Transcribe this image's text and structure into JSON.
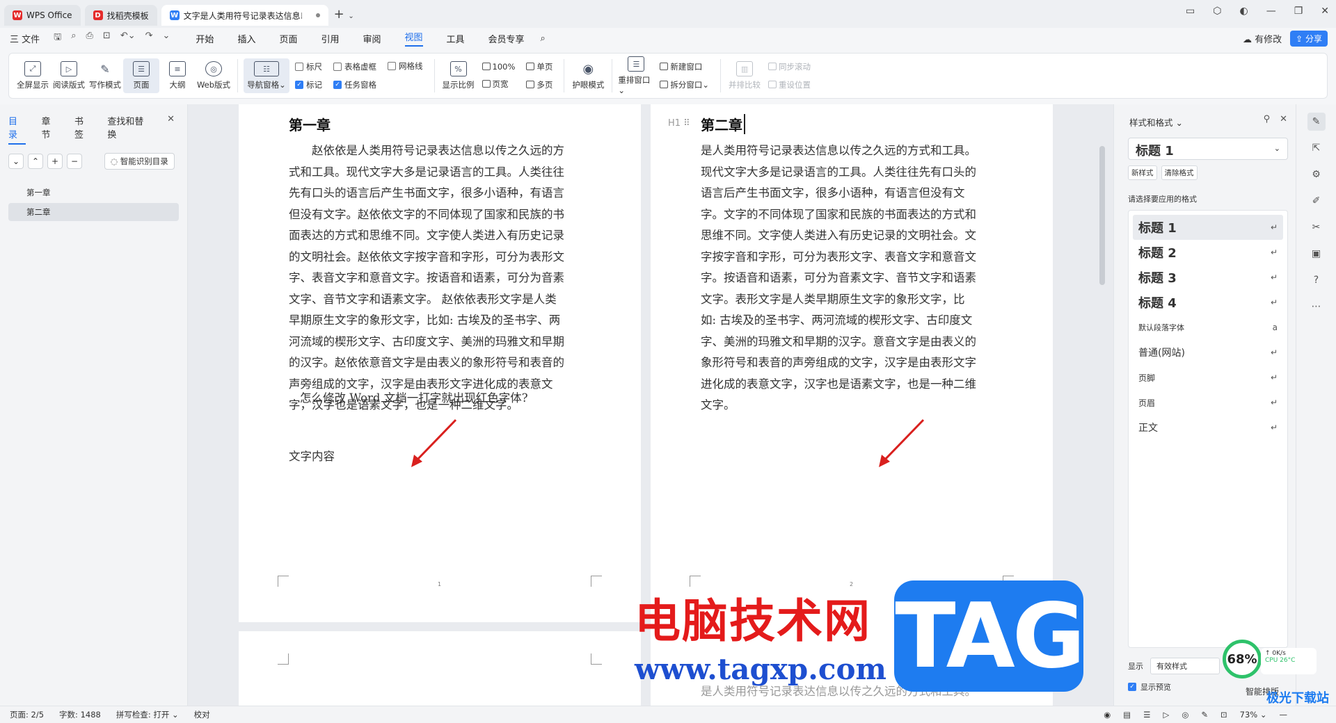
{
  "tabs": [
    {
      "label": "WPS Office",
      "logo": "W",
      "logo_color": "#e42b2b"
    },
    {
      "label": "找稻壳模板",
      "logo": "D",
      "logo_color": "#e42b2b"
    },
    {
      "label": "文字是人类用符号记录表达信息以",
      "logo": "W",
      "logo_color": "#2f7ef5"
    }
  ],
  "menubar": {
    "file": "三 文件",
    "items": [
      "开始",
      "插入",
      "页面",
      "引用",
      "审阅",
      "视图",
      "工具",
      "会员专享"
    ],
    "active": "视图",
    "modified": "有修改",
    "share": "分享"
  },
  "ribbon": {
    "view_buttons": [
      {
        "label": "全屏显示",
        "icon": "fullscreen-icon"
      },
      {
        "label": "阅读版式",
        "icon": "read-mode-icon"
      },
      {
        "label": "写作模式",
        "icon": "pen-icon"
      },
      {
        "label": "页面",
        "icon": "page-icon"
      },
      {
        "label": "大纲",
        "icon": "outline-icon"
      },
      {
        "label": "Web版式",
        "icon": "globe-icon"
      }
    ],
    "nav_pane": "导航窗格",
    "checks_col1": [
      {
        "label": "标尺",
        "checked": false
      },
      {
        "label": "标记",
        "checked": true
      }
    ],
    "checks_col2": [
      {
        "label": "表格虚框",
        "checked": false
      },
      {
        "label": "任务窗格",
        "checked": true
      }
    ],
    "checks_col3": [
      {
        "label": "网格线",
        "checked": false
      }
    ],
    "zoom_label": "显示比例",
    "zoom_100": "100%",
    "page_width": "页宽",
    "single_page": "单页",
    "multi_page": "多页",
    "eye_protect": "护眼模式",
    "rearrange": "重排窗口",
    "new_window": "新建窗口",
    "split_window": "拆分窗口",
    "side_by_side": "并排比较",
    "sync_scroll": "同步滚动",
    "reset_position": "重设位置"
  },
  "leftpanel": {
    "tabs": [
      "目录",
      "章节",
      "书签",
      "查找和替换"
    ],
    "smart_toc": "智能识别目录",
    "toc": [
      "第一章",
      "第二章"
    ],
    "selected": "第二章"
  },
  "doc": {
    "page1": {
      "heading": "第一章",
      "para1": "赵依依是人类用符号记录表达信息以传之久远的方式和工具。现代文字大多是记录语言的工具。人类往往先有口头的语言后产生书面文字，很多小语种，有语言但没有文字。赵依依文字的不同体现了国家和民族的书面表达的方式和思维不同。文字使人类进入有历史记录的文明社会。赵依依文字按字音和字形，可分为表形文字、表音文字和意音文字。按语音和语素，可分为音素文字、音节文字和语素文字。 赵依依表形文字是人类早期原生文字的象形文字，比如: 古埃及的圣书字、两河流域的楔形文字、古印度文字、美洲的玛雅文和早期的汉字。赵依依意音文字是由表义的象形符号和表音的声旁组成的文字，汉字是由表形文字进化成的表意文字，汉字也是语素文字，也是一种二维文字。",
      "para2": "怎么修改 Word 文档一打字就出现红色字体?",
      "para3": "文字内容",
      "page_number": "1"
    },
    "page2": {
      "heading": "第二章",
      "h_marker": "H1",
      "para1": "是人类用符号记录表达信息以传之久远的方式和工具。现代文字大多是记录语言的工具。人类往往先有口头的语言后产生书面文字，很多小语种，有语言但没有文字。文字的不同体现了国家和民族的书面表达的方式和思维不同。文字使人类进入有历史记录的文明社会。文字按字音和字形，可分为表形文字、表音文字和意音文字。按语音和语素，可分为音素文字、音节文字和语素文字。表形文字是人类早期原生文字的象形文字，比如: 古埃及的圣书字、两河流域的楔形文字、古印度文字、美洲的玛雅文和早期的汉字。意音文字是由表义的象形符号和表音的声旁组成的文字，汉字是由表形文字进化成的表意文字，汉字也是语素文字，也是一种二维文字。",
      "page_number": "2",
      "next_line": "是人类用符号记录表达信息以传之久远的方式和工具。"
    }
  },
  "rightpanel": {
    "title": "样式和格式",
    "current_style": "标题 1",
    "new_style": "新样式",
    "clear_format": "清除格式",
    "hint": "请选择要应用的格式",
    "styles": [
      {
        "label": "标题 1",
        "heading": true,
        "selected": true
      },
      {
        "label": "标题 2",
        "heading": true
      },
      {
        "label": "标题 3",
        "heading": true
      },
      {
        "label": "标题 4",
        "heading": true
      },
      {
        "label": "默认段落字体",
        "heading": false
      },
      {
        "label": "普通(网站)",
        "heading": false
      },
      {
        "label": "页脚",
        "heading": false
      },
      {
        "label": "页眉",
        "heading": false
      },
      {
        "label": "正文",
        "heading": false
      }
    ],
    "show_label": "显示",
    "show_value": "有效样式",
    "preview_label": "显示预览"
  },
  "statusbar": {
    "page": "页面: 2/5",
    "words": "字数: 1488",
    "spell": "拼写检查: 打开",
    "proof": "校对",
    "zoom": "73%"
  },
  "watermarks": {
    "site_cn": "电脑技术网",
    "site_url": "www.tagxp.com",
    "tag": "TAG",
    "perf_pct": "68%",
    "net": "0K/s",
    "cpu": "CPU 26°C",
    "smart_layout": "智能排版",
    "jiguang": "极光下载站"
  },
  "colors": {
    "accent": "#1f6feb",
    "arrow": "#d9201e"
  }
}
